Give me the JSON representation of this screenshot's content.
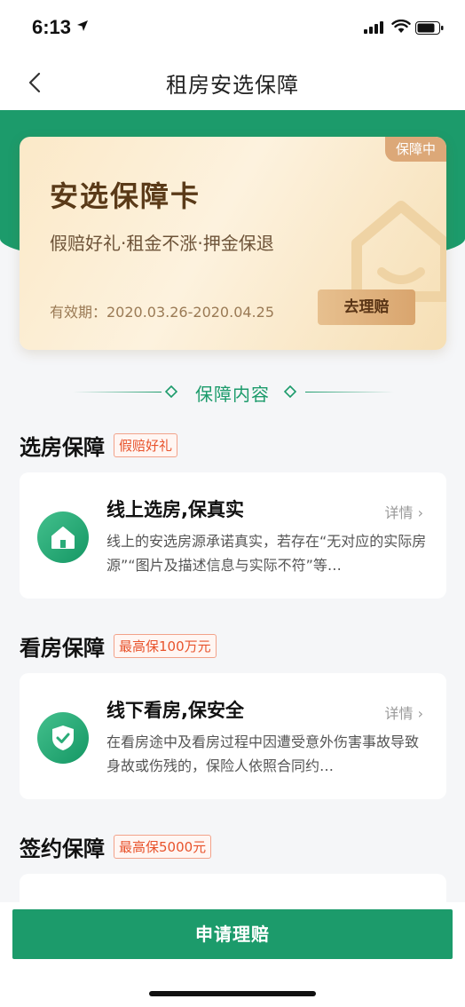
{
  "status_bar": {
    "time": "6:13",
    "icons": [
      "location-arrow-icon",
      "signal-icon",
      "wifi-icon",
      "battery-icon"
    ]
  },
  "nav": {
    "title": "租房安选保障",
    "back_icon": "chevron-left-icon"
  },
  "card": {
    "badge": "保障中",
    "title": "安选保障卡",
    "subtitle": "假赔好礼·租金不涨·押金保退",
    "validity": "有效期：2020.03.26-2020.04.25",
    "claim_button": "去理赔",
    "gradient_colors": [
      "#fbe9c8",
      "#f6dfb5"
    ]
  },
  "section": {
    "title": "保障内容",
    "accent_color": "#1c9b6b"
  },
  "categories": [
    {
      "title": "选房保障",
      "tag": "假赔好礼",
      "benefit": {
        "icon": "house-icon",
        "title": "线上选房,保真实",
        "detail": "详情 ›",
        "desc": "线上的安选房源承诺真实，若存在“无对应的实际房源”“图片及描述信息与实际不符”等…"
      }
    },
    {
      "title": "看房保障",
      "tag": "最高保100万元",
      "benefit": {
        "icon": "shield-check-icon",
        "title": "线下看房,保安全",
        "detail": "详情 ›",
        "desc": "在看房途中及看房过程中因遭受意外伤害事故导致身故或伤残的，保险人依照合同约…"
      }
    },
    {
      "title": "签约保障",
      "tag": "最高保5000元"
    }
  ],
  "bottom": {
    "apply_button": "申请理赔"
  },
  "colors": {
    "primary_green": "#1c9b6b",
    "tag_red": "#e8532c"
  }
}
